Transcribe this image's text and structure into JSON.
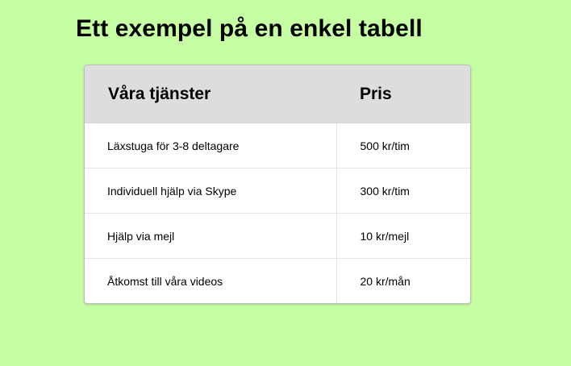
{
  "page": {
    "title": "Ett exempel på en enkel tabell",
    "background_color": "#c6ffa3"
  },
  "table": {
    "columns": [
      "Våra tjänster",
      "Pris"
    ],
    "rows": [
      {
        "service": "Läxstuga för 3-8 deltagare",
        "price": "500 kr/tim"
      },
      {
        "service": "Individuell hjälp via Skype",
        "price": "300 kr/tim"
      },
      {
        "service": "Hjälp via mejl",
        "price": "10 kr/mejl"
      },
      {
        "service": "Åtkomst till våra videos",
        "price": "20 kr/mån"
      }
    ],
    "header_color": "#dddddd"
  }
}
